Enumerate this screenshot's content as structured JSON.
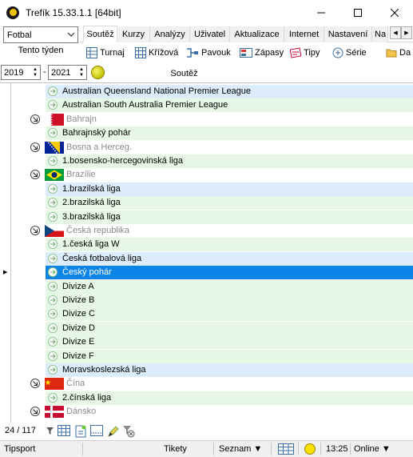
{
  "window": {
    "title": "Trefík 15.33.1.1 [64bit]"
  },
  "sport_select": {
    "value": "Fotbal"
  },
  "week_button": {
    "label": "Tento týden"
  },
  "tabs": [
    "Soutěž",
    "Kurzy",
    "Analýzy",
    "Uživatel",
    "Aktualizace",
    "Internet",
    "Nastavení",
    "Na"
  ],
  "toolbar": [
    "Turnaj",
    "Křížová",
    "Pavouk",
    "Zápasy",
    "Tipy",
    "Série",
    "Da"
  ],
  "years": {
    "from": "2019",
    "to": "2021",
    "dash": "-"
  },
  "column_header": "Soutěž",
  "rows": [
    {
      "type": "league",
      "label": "Australian Queensland National Premier League",
      "bg": "#dcecfa"
    },
    {
      "type": "league",
      "label": "Australian South Australia Premier League",
      "bg": "#e6f7e6"
    },
    {
      "type": "country",
      "label": "Bahrajn",
      "flag": "bahrain"
    },
    {
      "type": "league",
      "label": "Bahrajnský pohár",
      "bg": "#e6f7e6"
    },
    {
      "type": "country",
      "label": "Bosna a Herceg.",
      "flag": "bosnia"
    },
    {
      "type": "league",
      "label": "1.bosensko-hercegovinská liga",
      "bg": "#e6f7e6"
    },
    {
      "type": "country",
      "label": "Brazílie",
      "flag": "brazil"
    },
    {
      "type": "league",
      "label": "1.brazilská liga",
      "bg": "#dcecfa"
    },
    {
      "type": "league",
      "label": "2.brazilská liga",
      "bg": "#e6f7e6"
    },
    {
      "type": "league",
      "label": "3.brazilská liga",
      "bg": "#e6f7e6"
    },
    {
      "type": "country",
      "label": "Česká republika",
      "flag": "czech"
    },
    {
      "type": "league",
      "label": "1.česká liga W",
      "bg": "#e6f7e6"
    },
    {
      "type": "league",
      "label": "Česká fotbalová liga",
      "bg": "#dcecfa"
    },
    {
      "type": "league",
      "label": "Český pohár",
      "bg": "#dcecfa",
      "selected": true
    },
    {
      "type": "league",
      "label": "Divize A",
      "bg": "#e6f7e6"
    },
    {
      "type": "league",
      "label": "Divize B",
      "bg": "#e6f7e6"
    },
    {
      "type": "league",
      "label": "Divize C",
      "bg": "#e6f7e6"
    },
    {
      "type": "league",
      "label": "Divize D",
      "bg": "#e6f7e6"
    },
    {
      "type": "league",
      "label": "Divize E",
      "bg": "#e6f7e6"
    },
    {
      "type": "league",
      "label": "Divize F",
      "bg": "#e6f7e6"
    },
    {
      "type": "league",
      "label": "Moravskoslezská liga",
      "bg": "#dcecfa"
    },
    {
      "type": "country",
      "label": "Čína",
      "flag": "china"
    },
    {
      "type": "league",
      "label": "2.čínská liga",
      "bg": "#e6f7e6"
    },
    {
      "type": "country",
      "label": "Dánsko",
      "flag": "denmark"
    }
  ],
  "counter": "24 / 117",
  "status": {
    "provider": "Tipsport",
    "tickets": "Tikety",
    "list": "Seznam ▼",
    "time": "13:25",
    "online": "Online ▼"
  }
}
